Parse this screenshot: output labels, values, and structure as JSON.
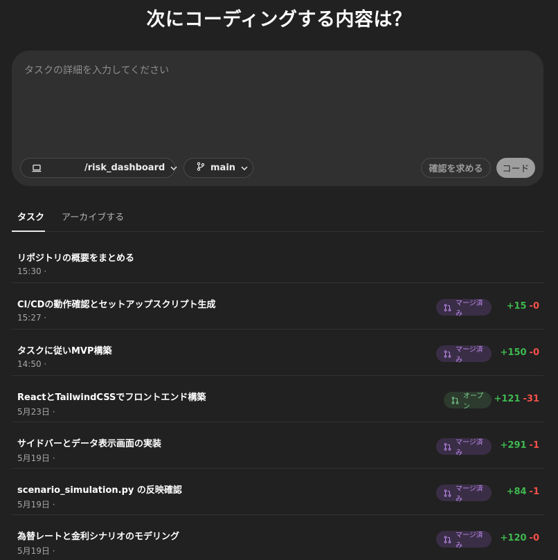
{
  "heading": "次にコーディングする内容は？",
  "composer": {
    "placeholder": "タスクの詳細を入力してください",
    "repo": "/risk_dashboard",
    "branch": "main",
    "ask_button": "確認を求める",
    "code_button": "コード"
  },
  "tabs": [
    {
      "label": "タスク",
      "active": true
    },
    {
      "label": "アーカイブする",
      "active": false
    }
  ],
  "colors": {
    "additions": "#3fb950",
    "deletions": "#f85149",
    "merged_badge": "#c08cf0",
    "open_badge": "#7fd191"
  },
  "tasks": [
    {
      "title": "リポジトリの概要をまとめる",
      "meta": "15:30 ·",
      "status": "",
      "additions": "",
      "deletions": ""
    },
    {
      "title": "CI/CDの動作確認とセットアップスクリプト生成",
      "meta": "15:27 ·",
      "status": "マージ済み",
      "additions": "+15",
      "deletions": "-0"
    },
    {
      "title": "タスクに従いMVP構築",
      "meta": "14:50 ·",
      "status": "マージ済み",
      "additions": "+150",
      "deletions": "-0"
    },
    {
      "title": "ReactとTailwindCSSでフロントエンド構築",
      "meta": "5月23日 ·",
      "status": "オープン",
      "additions": "+121",
      "deletions": "-31"
    },
    {
      "title": "サイドバーとデータ表示画面の実装",
      "meta": "5月19日 ·",
      "status": "マージ済み",
      "additions": "+291",
      "deletions": "-1"
    },
    {
      "title": "scenario_simulation.py の反映確認",
      "meta": "5月19日 ·",
      "status": "マージ済み",
      "additions": "+84",
      "deletions": "-1"
    },
    {
      "title": "為替レートと金利シナリオのモデリング",
      "meta": "5月19日 ·",
      "status": "マージ済み",
      "additions": "+120",
      "deletions": "-0"
    }
  ]
}
